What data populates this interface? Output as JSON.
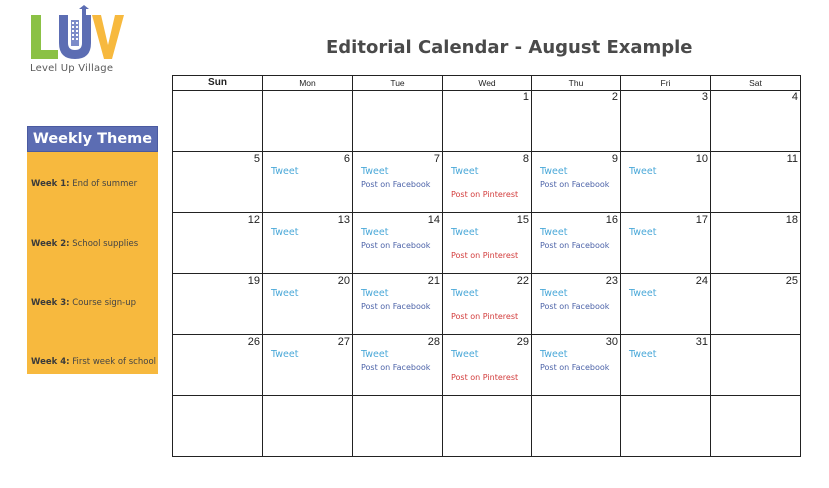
{
  "logo": {
    "letters": "LUV",
    "text": "Level Up Village",
    "colors": {
      "l": "#8bc145",
      "u": "#5c6db3",
      "v": "#f7b93e"
    }
  },
  "title": "Editorial Calendar - August Example",
  "theme": {
    "header": "Weekly Theme",
    "weeks": [
      {
        "label": "Week 1:",
        "text": "End of summer"
      },
      {
        "label": "Week 2:",
        "text": "School supplies"
      },
      {
        "label": "Week 3:",
        "text": "Course sign-up"
      },
      {
        "label": "Week 4:",
        "text": "First week of school"
      }
    ]
  },
  "calendar": {
    "days": [
      "Sun",
      "Mon",
      "Tue",
      "Wed",
      "Thu",
      "Fri",
      "Sat"
    ],
    "weeks": [
      [
        {
          "num": "",
          "tweet": "",
          "fb": "",
          "pin": ""
        },
        {
          "num": "",
          "tweet": "",
          "fb": "",
          "pin": ""
        },
        {
          "num": "",
          "tweet": "",
          "fb": "",
          "pin": ""
        },
        {
          "num": "1",
          "tweet": "",
          "fb": "",
          "pin": ""
        },
        {
          "num": "2",
          "tweet": "",
          "fb": "",
          "pin": ""
        },
        {
          "num": "3",
          "tweet": "",
          "fb": "",
          "pin": ""
        },
        {
          "num": "4",
          "tweet": "",
          "fb": "",
          "pin": ""
        }
      ],
      [
        {
          "num": "5",
          "tweet": "",
          "fb": "",
          "pin": ""
        },
        {
          "num": "6",
          "tweet": "Tweet",
          "fb": "",
          "pin": ""
        },
        {
          "num": "7",
          "tweet": "Tweet",
          "fb": "Post on Facebook",
          "pin": ""
        },
        {
          "num": "8",
          "tweet": "Tweet",
          "fb": "",
          "pin": "Post on Pinterest"
        },
        {
          "num": "9",
          "tweet": "Tweet",
          "fb": "Post on Facebook",
          "pin": ""
        },
        {
          "num": "10",
          "tweet": "Tweet",
          "fb": "",
          "pin": ""
        },
        {
          "num": "11",
          "tweet": "",
          "fb": "",
          "pin": ""
        }
      ],
      [
        {
          "num": "12",
          "tweet": "",
          "fb": "",
          "pin": ""
        },
        {
          "num": "13",
          "tweet": "Tweet",
          "fb": "",
          "pin": ""
        },
        {
          "num": "14",
          "tweet": "Tweet",
          "fb": "Post on Facebook",
          "pin": ""
        },
        {
          "num": "15",
          "tweet": "Tweet",
          "fb": "",
          "pin": "Post on Pinterest"
        },
        {
          "num": "16",
          "tweet": "Tweet",
          "fb": "Post on Facebook",
          "pin": ""
        },
        {
          "num": "17",
          "tweet": "Tweet",
          "fb": "",
          "pin": ""
        },
        {
          "num": "18",
          "tweet": "",
          "fb": "",
          "pin": ""
        }
      ],
      [
        {
          "num": "19",
          "tweet": "",
          "fb": "",
          "pin": ""
        },
        {
          "num": "20",
          "tweet": "Tweet",
          "fb": "",
          "pin": ""
        },
        {
          "num": "21",
          "tweet": "Tweet",
          "fb": "Post on Facebook",
          "pin": ""
        },
        {
          "num": "22",
          "tweet": "Tweet",
          "fb": "",
          "pin": "Post on Pinterest"
        },
        {
          "num": "23",
          "tweet": "Tweet",
          "fb": "Post on Facebook",
          "pin": ""
        },
        {
          "num": "24",
          "tweet": "Tweet",
          "fb": "",
          "pin": ""
        },
        {
          "num": "25",
          "tweet": "",
          "fb": "",
          "pin": ""
        }
      ],
      [
        {
          "num": "26",
          "tweet": "",
          "fb": "",
          "pin": ""
        },
        {
          "num": "27",
          "tweet": "Tweet",
          "fb": "",
          "pin": ""
        },
        {
          "num": "28",
          "tweet": "Tweet",
          "fb": "Post on Facebook",
          "pin": ""
        },
        {
          "num": "29",
          "tweet": "Tweet",
          "fb": "",
          "pin": "Post on Pinterest"
        },
        {
          "num": "30",
          "tweet": "Tweet",
          "fb": "Post on Facebook",
          "pin": ""
        },
        {
          "num": "31",
          "tweet": "Tweet",
          "fb": "",
          "pin": ""
        },
        {
          "num": "",
          "tweet": "",
          "fb": "",
          "pin": ""
        }
      ],
      [
        {
          "num": "",
          "tweet": "",
          "fb": "",
          "pin": ""
        },
        {
          "num": "",
          "tweet": "",
          "fb": "",
          "pin": ""
        },
        {
          "num": "",
          "tweet": "",
          "fb": "",
          "pin": ""
        },
        {
          "num": "",
          "tweet": "",
          "fb": "",
          "pin": ""
        },
        {
          "num": "",
          "tweet": "",
          "fb": "",
          "pin": ""
        },
        {
          "num": "",
          "tweet": "",
          "fb": "",
          "pin": ""
        },
        {
          "num": "",
          "tweet": "",
          "fb": "",
          "pin": ""
        }
      ]
    ]
  }
}
